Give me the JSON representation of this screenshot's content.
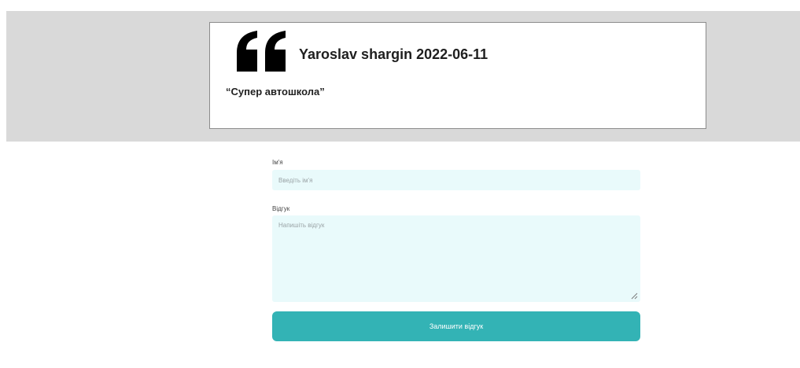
{
  "review": {
    "author": "Yaroslav shargin",
    "date": "2022-06-11",
    "text": "“Супер автошкола”",
    "icon": "quote-icon"
  },
  "form": {
    "name_label": "Ім'я",
    "name_placeholder": "Введіть ім'я",
    "review_label": "Відгук",
    "review_placeholder": "Напишіть відгук",
    "submit_label": "Залишити відгук"
  },
  "colors": {
    "band_background": "#d9d9d9",
    "input_background": "#e9fafb",
    "button_background": "#33b3b5"
  }
}
